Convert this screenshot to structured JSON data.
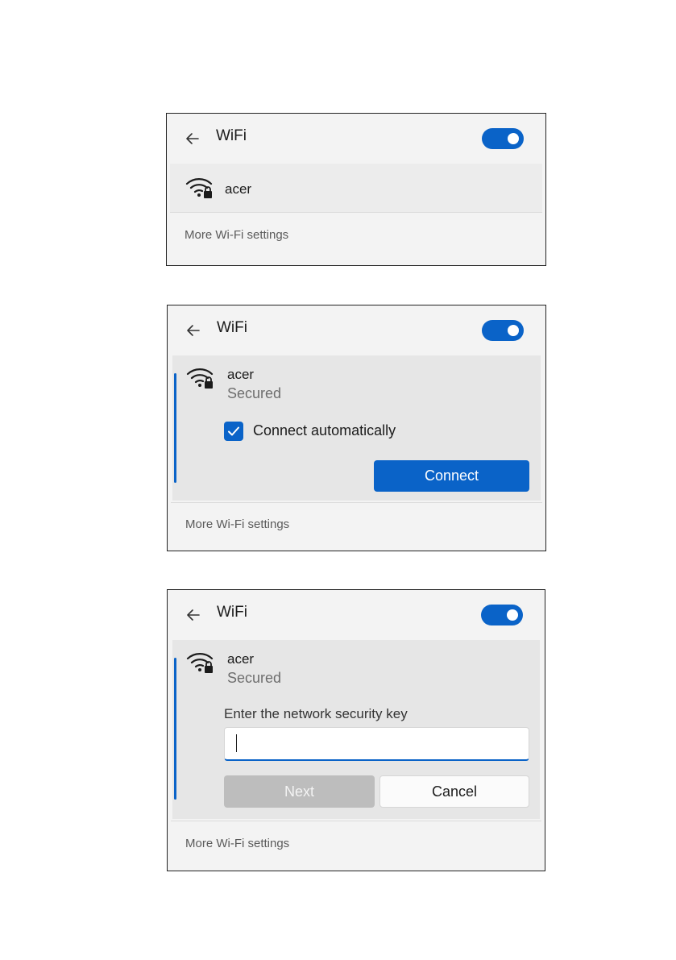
{
  "panels": [
    {
      "title": "WiFi",
      "network": {
        "name": "acer"
      },
      "more_link": "More Wi-Fi settings"
    },
    {
      "title": "WiFi",
      "network": {
        "name": "acer",
        "status": "Secured"
      },
      "checkbox_label": "Connect automatically",
      "connect_label": "Connect",
      "more_link": "More Wi-Fi settings"
    },
    {
      "title": "WiFi",
      "network": {
        "name": "acer",
        "status": "Secured"
      },
      "key_prompt": "Enter the network security key",
      "next_label": "Next",
      "cancel_label": "Cancel",
      "more_link": "More Wi-Fi settings"
    }
  ],
  "icons": {
    "back": "back-arrow-icon",
    "wifi": "wifi-secured-icon",
    "check": "checkmark-icon"
  },
  "colors": {
    "accent": "#0a63c8",
    "panel_bg": "#f3f3f3",
    "disabled": "#bdbdbd"
  }
}
